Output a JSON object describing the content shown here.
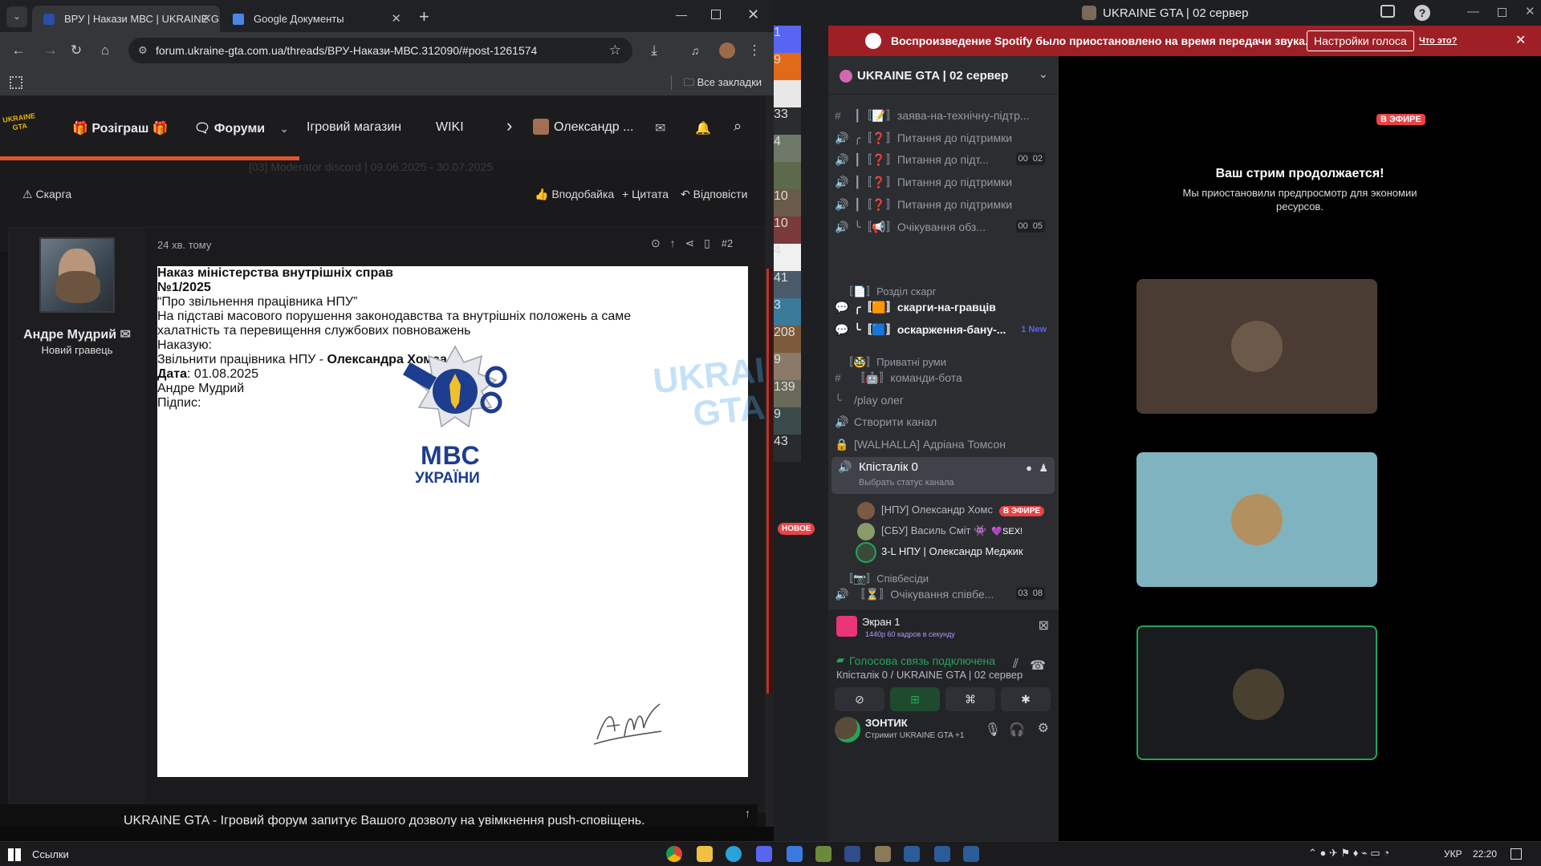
{
  "browser": {
    "tabs": [
      {
        "title": "ВРУ | Накази МВС | UKRAINE G",
        "active": true
      },
      {
        "title": "Google Документы",
        "active": false
      }
    ],
    "new_tab_label": "+",
    "url": "forum.ukraine-gta.com.ua/threads/ВРУ-Накази-МВС.312090/#post-1261574",
    "bookmarks_label": "Все закладки"
  },
  "forum": {
    "logo_text": "UKRAINE GTA",
    "nav": {
      "giveaway": "Розіграш",
      "forums": "Форуми",
      "shop": "Ігровий магазин",
      "wiki": "WIKI",
      "user": "Олександр ..."
    },
    "faded_line": "[03] Moderator discord | 09.06.2025 - 30.07.2025",
    "actions": {
      "report": "Скарга",
      "like": "Вподобайка",
      "quote": "Цитата",
      "reply": "Відповісти"
    },
    "post": {
      "time": "24 хв. тому",
      "number": "#2",
      "author": "Андре Мудрий",
      "author_rank": "Новий гравець"
    },
    "document": {
      "logo_line1": "МВС",
      "logo_line2": "УКРАЇНИ",
      "heading": "Наказ міністерства внутрішніх справ",
      "number": "№1/2025",
      "subject": "“Про звільнення працівника НПУ”",
      "body1": "На підставі масового порушення законодавства та внутрішніх положень а саме",
      "body2": "халатність та перевищення службових повноважень",
      "order_label": "Наказую:",
      "dismiss_text": "Звільнити працівника НПУ - ",
      "dismiss_name": "Олександра Хомса",
      "date_label": "Дата",
      "date_value": ": 01.08.2025",
      "signer": "Андре Мудрий",
      "signature_label": "Підпис:"
    },
    "watermark": "UKRAINE GTA",
    "push_notice": "UKRAINE GTA - Ігровий форум запитує Вашого дозволу на увімкнення push-сповіщень."
  },
  "discord": {
    "window_title": "UKRAINE GTA | 02 сервер",
    "spotify_notice": "Воспроизведение Spotify было приостановлено на время передачи звука.",
    "spotify_button": "Настройки голоса",
    "spotify_link": "Что это?",
    "server_name": "UKRAINE GTA | 02 сервер",
    "guild_badges": [
      "1",
      "9",
      "",
      "33",
      "4",
      "",
      "10",
      "10",
      "4",
      "41",
      "3",
      "208",
      "9",
      "139",
      "9",
      "43"
    ],
    "new_badge": "НОВОЕ",
    "channels": [
      {
        "sym": "#",
        "name": "┃〚📝〛заява-на-технічну-підтр...",
        "count": ""
      },
      {
        "sym": "🔊",
        "name": "╭〚❓〛Питання до підтримки",
        "count": ""
      },
      {
        "sym": "🔊",
        "name": "┃〚❓〛Питання до підт...",
        "count_a": "00",
        "count_b": "02"
      },
      {
        "sym": "🔊",
        "name": "┃〚❓〛Питання до підтримки",
        "count": ""
      },
      {
        "sym": "🔊",
        "name": "┃〚❓〛Питання до підтримки",
        "count": ""
      },
      {
        "sym": "🔊",
        "name": "╰〚📢〛Очікування обз...",
        "count_a": "00",
        "count_b": "05"
      }
    ],
    "cat_complaints": "〚📄〛Розділ скарг",
    "forum_channels": [
      {
        "name": "╭〚🟧〛скарги-на-гравців",
        "tag": ""
      },
      {
        "name": "╰〚🟦〛оскарження-бану-...",
        "tag": "1 New"
      }
    ],
    "cat_private": "〚🥸〛Приватні руми",
    "private_channels": [
      {
        "sym": "#",
        "name": "〚🤖〛команди-бота"
      },
      {
        "sym": "╰",
        "name": "/play олег"
      },
      {
        "sym": "🔊",
        "name": "Створити канал"
      },
      {
        "sym": "🔒",
        "name": "[WALHALLA] Адріана Томсон"
      }
    ],
    "active_channel": {
      "name": "Кпісталік 0",
      "status": "Выбрать статус канала"
    },
    "voice_users": [
      {
        "name": "[НПУ] Олександр Хомс",
        "tag": "В ЭФИРЕ"
      },
      {
        "name": "[СБУ] Василь Сміт 👾",
        "tag": "💜SEX!"
      },
      {
        "name": "3-L НПУ | Олександр Меджик",
        "tag": ""
      }
    ],
    "cat_interviews": "〚📷〛Співбесіди",
    "interview_channel": {
      "name": "〚⏳〛Очікування співбе...",
      "count_a": "03",
      "count_b": "08"
    },
    "screen_panel": {
      "title": "Экран 1",
      "quality": "1440p 60 кадров в секунду"
    },
    "voice_panel": {
      "status": "Голосова связь подключена",
      "channel": "Кпісталік 0 / UKRAINE GTA | 02 сервер"
    },
    "user_panel": {
      "name": "ЗОНТИК",
      "status": "Стримит UKRAINE GTA +1"
    },
    "stream": {
      "live_badge": "В ЭФИРЕ",
      "title": "Ваш стрим продолжается!",
      "subtitle1": "Мы приостановили предпросмотр для экономии",
      "subtitle2": "ресурсов."
    }
  },
  "taskbar": {
    "links_label": "Ссылки",
    "lang": "УКР",
    "time": "22:20"
  },
  "colors": {
    "accent_orange": "#e0552b",
    "discord_red": "#ed4245",
    "spotify_bar": "#9f1f26",
    "voice_green": "#23a55a"
  }
}
